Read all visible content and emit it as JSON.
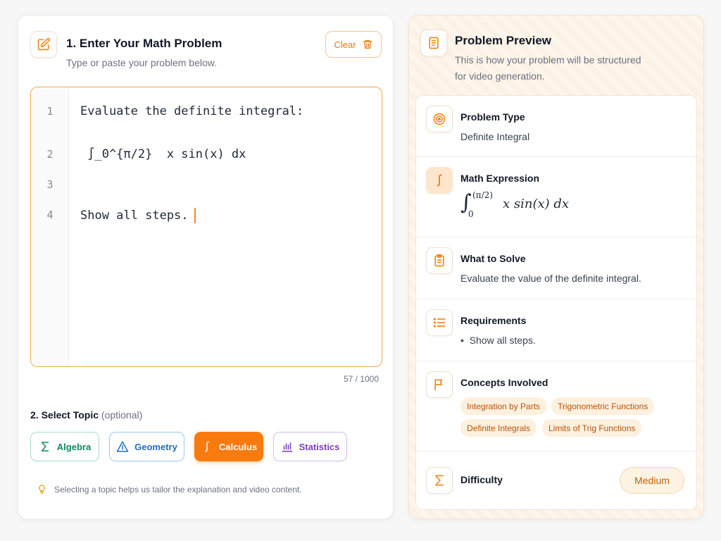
{
  "input_panel": {
    "title": "1. Enter Your Math Problem",
    "subtitle": "Type or paste your problem below.",
    "clear_label": "Clear",
    "editor": {
      "lines": [
        {
          "number": "1",
          "text": "Evaluate the definite integral:"
        },
        {
          "number": "2",
          "text": " ∫_0^{π/2}  x sin(x) dx"
        },
        {
          "number": "3",
          "text": ""
        },
        {
          "number": "4",
          "text": "Show all steps."
        }
      ],
      "counter": "57 / 1000"
    },
    "topic": {
      "label": "2. Select Topic",
      "optional": "(optional)",
      "selected": "Calculus",
      "chips": [
        {
          "label": "Algebra",
          "icon": "sigma-icon",
          "color": "#108a5c"
        },
        {
          "label": "Geometry",
          "icon": "triangle-icon",
          "color": "#1d6fc2"
        },
        {
          "label": "Calculus",
          "icon": "integral-icon",
          "color": "#f97a0d"
        },
        {
          "label": "Statistics",
          "icon": "bar-chart-icon",
          "color": "#7b3ec2"
        }
      ]
    },
    "hint": "Selecting a topic helps us tailor the explanation and video content."
  },
  "preview_panel": {
    "title": "Problem Preview",
    "subtitle_line1": "This is how your problem will be structured",
    "subtitle_line2": "for video generation.",
    "problem_type": {
      "title": "Problem Type",
      "value": "Definite Integral",
      "icon": "target-icon"
    },
    "math_expression": {
      "title": "Math Expression",
      "integral": "∫",
      "upper": "(π/2)",
      "lower": "0",
      "body": "x sin(x) dx",
      "icon": "integral-icon"
    },
    "what_to_solve": {
      "title": "What to Solve",
      "value": "Evaluate the value of the definite integral.",
      "icon": "clipboard-icon"
    },
    "requirements": {
      "title": "Requirements",
      "items": [
        "Show all steps."
      ],
      "icon": "list-icon"
    },
    "concepts": {
      "title": "Concepts Involved",
      "icon": "flag-icon",
      "tags": [
        "Integration by Parts",
        "Trigonometric Functions",
        "Definite Integrals",
        "Limits of Trig Functions"
      ]
    },
    "difficulty": {
      "title": "Difficulty",
      "value": "Medium",
      "icon": "sigma-icon"
    }
  },
  "accent_color": "#f97a0d"
}
